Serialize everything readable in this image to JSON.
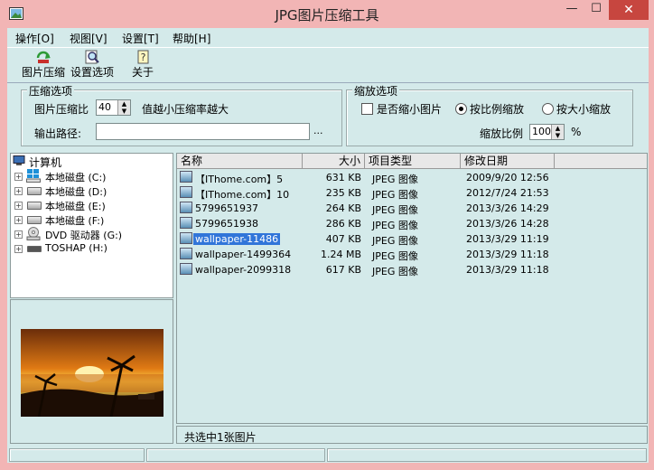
{
  "window": {
    "title": "JPG图片压缩工具",
    "min_glyph": "—",
    "max_glyph": "☐",
    "close_glyph": "✕"
  },
  "menu": [
    "操作[O]",
    "视图[V]",
    "设置[T]",
    "帮助[H]"
  ],
  "toolbar": {
    "compress_label": "图片压缩",
    "settings_label": "设置选项",
    "about_label": "关于"
  },
  "compress": {
    "group_title": "压缩选项",
    "ratio_label": "图片压缩比",
    "ratio_value": "40",
    "hint": "值越小压缩率越大",
    "output_label": "输出路径:",
    "output_value": "",
    "browse_label": "..."
  },
  "scale": {
    "group_title": "缩放选项",
    "shrink_label": "是否缩小图片",
    "shrink_checked": false,
    "by_ratio_label": "按比例缩放",
    "by_size_label": "按大小缩放",
    "selected_mode": "by_ratio",
    "ratio_label": "缩放比例",
    "ratio_value": "100",
    "unit": "%"
  },
  "tree": {
    "root": "计算机",
    "drives": [
      {
        "name": "本地磁盘",
        "letter": "(C:)"
      },
      {
        "name": "本地磁盘",
        "letter": "(D:)"
      },
      {
        "name": "本地磁盘",
        "letter": "(E:)"
      },
      {
        "name": "本地磁盘",
        "letter": "(F:)"
      },
      {
        "name": "DVD 驱动器",
        "letter": "(G:)"
      },
      {
        "name": "TOSHAP",
        "letter": "(H:)"
      }
    ]
  },
  "list": {
    "columns": [
      "名称",
      "大小",
      "项目类型",
      "修改日期"
    ],
    "rows": [
      {
        "name": "【IThome.com】5",
        "size": "631 KB",
        "type": "JPEG 图像",
        "date": "2009/9/20 12:56"
      },
      {
        "name": "【IThome.com】10",
        "size": "235 KB",
        "type": "JPEG 图像",
        "date": "2012/7/24 21:53"
      },
      {
        "name": "5799651937",
        "size": "264 KB",
        "type": "JPEG 图像",
        "date": "2013/3/26 14:29"
      },
      {
        "name": "5799651938",
        "size": "286 KB",
        "type": "JPEG 图像",
        "date": "2013/3/26 14:28"
      },
      {
        "name": "wallpaper-11486",
        "size": "407 KB",
        "type": "JPEG 图像",
        "date": "2013/3/29 11:19"
      },
      {
        "name": "wallpaper-1499364",
        "size": "1.24 MB",
        "type": "JPEG 图像",
        "date": "2013/3/29 11:18"
      },
      {
        "name": "wallpaper-2099318",
        "size": "617 KB",
        "type": "JPEG 图像",
        "date": "2013/3/29 11:18"
      }
    ],
    "selected_index": 4,
    "status": "共选中1张图片"
  },
  "colors": {
    "titlebar": "#f2b5b5",
    "client": "#d4eaea",
    "selection": "#3175d9",
    "close": "#c7463f"
  }
}
